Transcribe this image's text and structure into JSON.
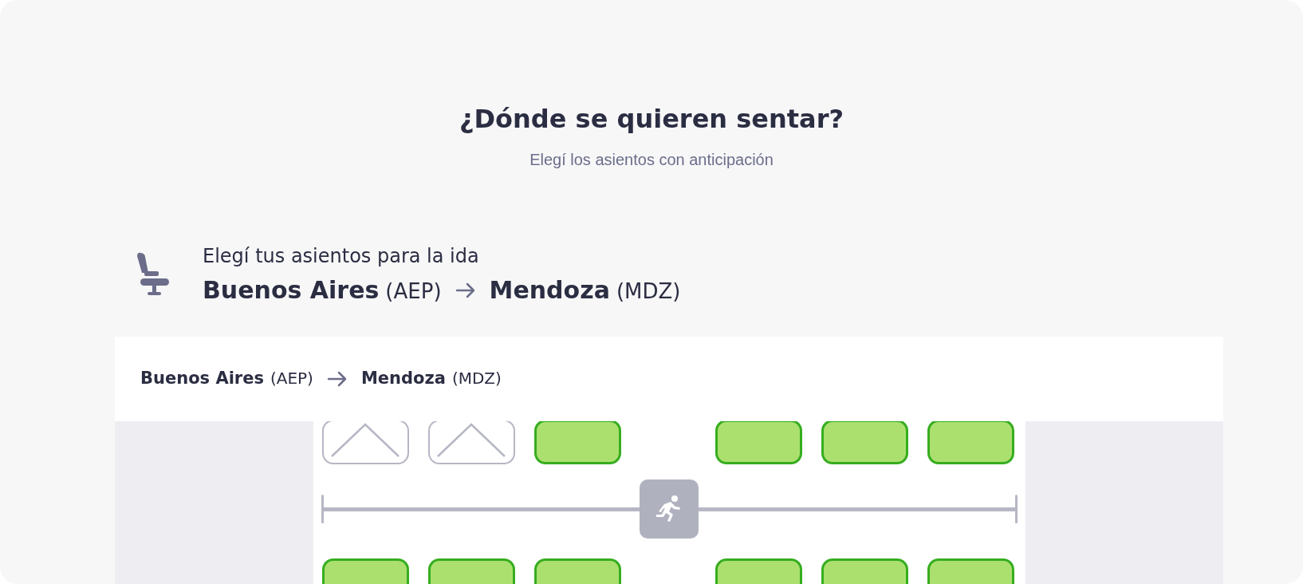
{
  "heading": {
    "title": "¿Dónde se quieren sentar?",
    "subtitle": "Elegí los asientos con anticipación"
  },
  "leg": {
    "label": "Elegí tus asientos para la ida",
    "origin": {
      "city": "Buenos Aires",
      "code": "(AEP)"
    },
    "destination": {
      "city": "Mendoza",
      "code": "(MDZ)"
    }
  },
  "seat_map": {
    "route": {
      "origin": {
        "city": "Buenos Aires",
        "code": "(AEP)"
      },
      "destination": {
        "city": "Mendoza",
        "code": "(MDZ)"
      }
    },
    "rows": [
      {
        "seats": [
          {
            "available": false
          },
          {
            "available": false
          },
          {
            "available": true
          },
          {
            "available": true
          },
          {
            "available": true
          },
          {
            "available": true
          }
        ]
      },
      {
        "kind": "exit"
      },
      {
        "seats": [
          {
            "available": true
          },
          {
            "available": true
          },
          {
            "available": true
          },
          {
            "available": true
          },
          {
            "available": true
          },
          {
            "available": true
          }
        ]
      }
    ]
  }
}
